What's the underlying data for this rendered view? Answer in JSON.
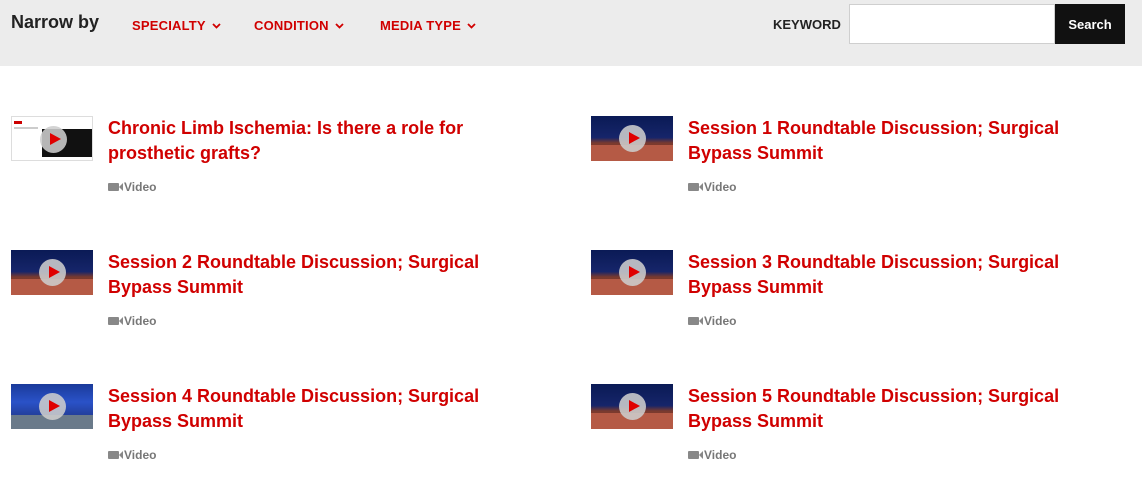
{
  "filters": {
    "narrow_label": "Narrow by",
    "specialty": "SPECIALTY",
    "condition": "CONDITION",
    "media_type": "MEDIA TYPE",
    "keyword_label": "KEYWORD",
    "keyword_value": "",
    "search_button": "Search"
  },
  "items": [
    {
      "title": "Chronic Limb Ischemia: Is there a role for prosthetic grafts?",
      "type": "Video",
      "thumb": "slide"
    },
    {
      "title": "Session 1 Roundtable Discussion; Surgical Bypass Summit",
      "type": "Video",
      "thumb": "dark"
    },
    {
      "title": "Session 2 Roundtable Discussion; Surgical Bypass Summit",
      "type": "Video",
      "thumb": "dark"
    },
    {
      "title": "Session 3 Roundtable Discussion; Surgical Bypass Summit",
      "type": "Video",
      "thumb": "dark"
    },
    {
      "title": "Session 4 Roundtable Discussion; Surgical Bypass Summit",
      "type": "Video",
      "thumb": "blue"
    },
    {
      "title": "Session 5 Roundtable Discussion; Surgical Bypass Summit",
      "type": "Video",
      "thumb": "dark"
    }
  ],
  "colors": {
    "accent": "#d00000",
    "filter_bar": "#ececec",
    "button": "#111111"
  },
  "icons": [
    "chevron-down-icon",
    "play-icon",
    "video-camera-icon"
  ]
}
